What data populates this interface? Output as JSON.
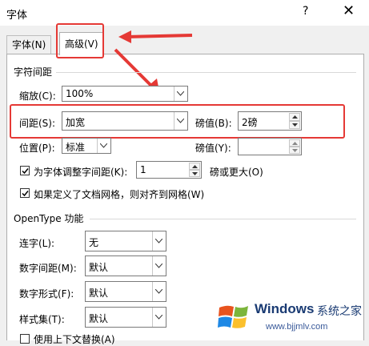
{
  "window": {
    "title": "字体",
    "help": "?",
    "close": "✕"
  },
  "tabs": [
    {
      "label": "字体(N)"
    },
    {
      "label": "高级(V)"
    }
  ],
  "section_char_spacing": "字符间距",
  "scale": {
    "label": "缩放(C):",
    "value": "100%"
  },
  "spacing": {
    "label": "间距(S):",
    "value": "加宽"
  },
  "spacing_pt": {
    "label": "磅值(B):",
    "value": "2磅"
  },
  "position": {
    "label": "位置(P):",
    "value": "标准"
  },
  "position_pt": {
    "label": "磅值(Y):",
    "value": ""
  },
  "kerning": {
    "label": "为字体调整字间距(K):",
    "value": "1",
    "suffix": "磅或更大(O)"
  },
  "grid": {
    "label": "如果定义了文档网格，则对齐到网格(W)"
  },
  "section_opentype": "OpenType 功能",
  "ligatures": {
    "label": "连字(L):",
    "value": "无"
  },
  "num_spacing": {
    "label": "数字间距(M):",
    "value": "默认"
  },
  "num_forms": {
    "label": "数字形式(F):",
    "value": "默认"
  },
  "stylistic_sets": {
    "label": "样式集(T):",
    "value": "默认"
  },
  "contextual": {
    "label": "使用上下文替换(A)"
  },
  "watermark": {
    "name": "Windows",
    "site": "系统之家",
    "url": "www.bjjmlv.com"
  },
  "colors": {
    "annotation_red": "#e53935",
    "dialog_bg": "#f0f0f0"
  }
}
